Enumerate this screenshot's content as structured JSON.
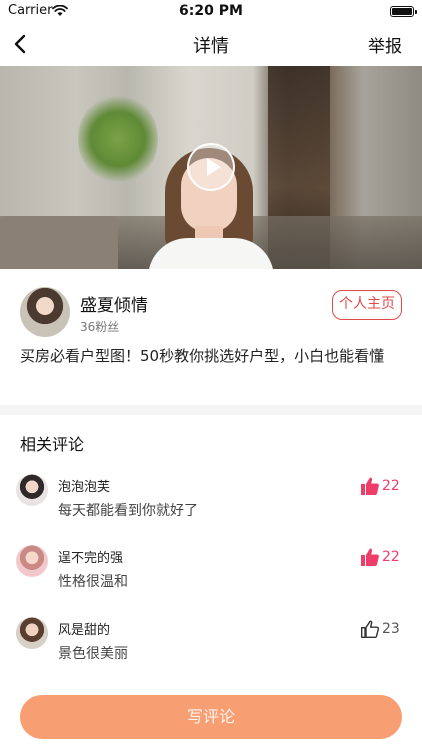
{
  "status_bar": {
    "carrier": "Carrier",
    "time": "6:20 PM"
  },
  "nav": {
    "title": "详情",
    "report_label": "举报",
    "back_icon": "chevron-left-icon"
  },
  "video": {
    "play_icon": "play-icon"
  },
  "author": {
    "name": "盛夏倾情",
    "fans": "36粉丝",
    "profile_button_label": "个人主页",
    "description": "买房必看户型图！50秒教你挑选好户型，小白也能看懂"
  },
  "comments_section": {
    "title": "相关评论",
    "comments": [
      {
        "name": "泡泡泡芙",
        "text": "每天都能看到你就好了",
        "likes": "22",
        "liked": true
      },
      {
        "name": "逞不完的强",
        "text": "性格很温和",
        "likes": "22",
        "liked": true
      },
      {
        "name": "风是甜的",
        "text": "景色很美丽",
        "likes": "23",
        "liked": false
      }
    ]
  },
  "write_comment_label": "写评论",
  "colors": {
    "accent": "#e24a4a",
    "like_active": "#ef3d6a",
    "write_button": "#f79e73"
  }
}
